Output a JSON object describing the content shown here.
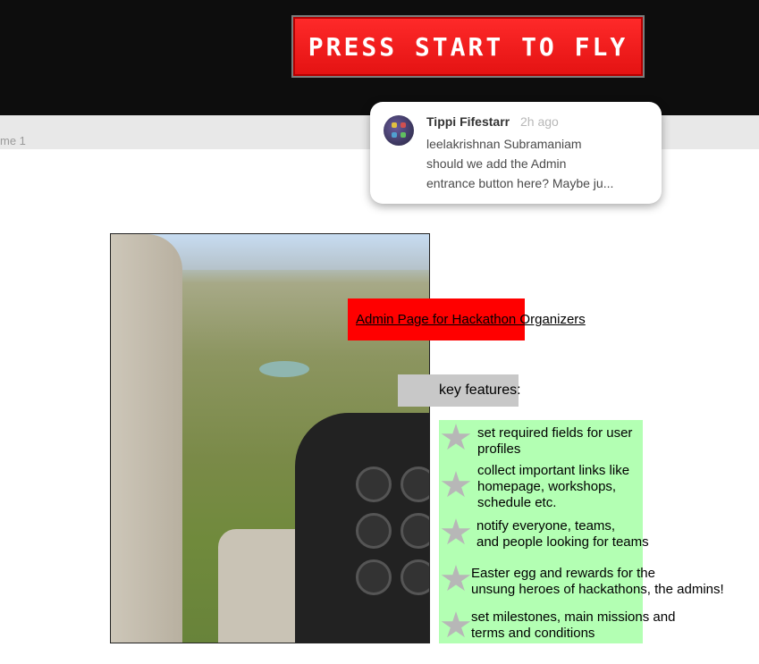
{
  "header": {
    "start_button_label": "PRESS START TO FLY"
  },
  "canvas": {
    "frame_label": "me 1"
  },
  "comment": {
    "author": "Tippi Fifestarr",
    "time": "2h ago",
    "lines": [
      "leelakrishnan Subramaniam",
      "should we add the Admin",
      "entrance button here? Maybe ju..."
    ]
  },
  "content": {
    "heading": "Admin Page for Hackathon Organizers",
    "key_features_label": "key features:",
    "features": [
      [
        "set required fields for user",
        "profiles"
      ],
      [
        "collect important links like",
        "homepage, workshops,",
        "schedule etc."
      ],
      [
        "notify everyone, teams,",
        "and people looking for teams"
      ],
      [
        "Easter egg and rewards for the",
        "unsung heroes of hackathons, the admins!"
      ],
      [
        "set milestones, main missions and",
        "terms and conditions"
      ]
    ],
    "feature_icon": "star-icon"
  },
  "colors": {
    "start_button": "#ff1a1a",
    "heading_highlight": "#ff0000",
    "feature_panel": "#b3ffb3",
    "key_features_box": "#c8c8c8"
  }
}
